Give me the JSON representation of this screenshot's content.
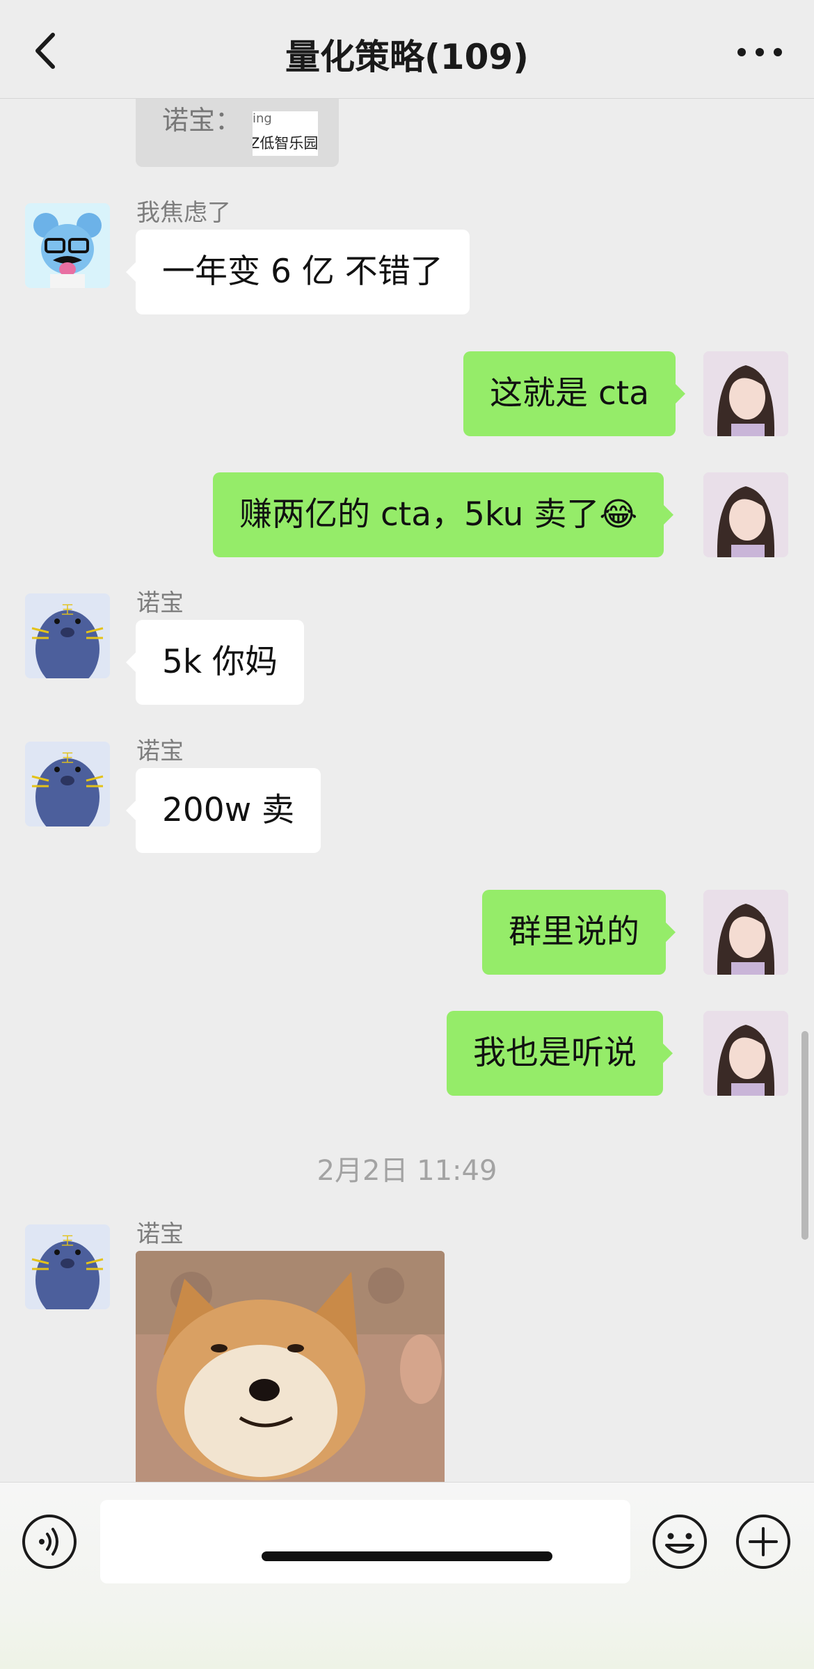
{
  "header": {
    "title": "量化策略(109)",
    "back_icon": "chevron-left-icon",
    "more_icon": "more-dots-icon"
  },
  "quote": {
    "name": "诺宝：",
    "thumb_line1": "ing",
    "thumb_line2": "Z低智乐园"
  },
  "messages": [
    {
      "side": "left",
      "sender": "我焦虑了",
      "text": "一年变 6 亿 不错了"
    },
    {
      "side": "right",
      "text": "这就是 cta"
    },
    {
      "side": "right",
      "text": "赚两亿的 cta，5ku 卖了😂"
    },
    {
      "side": "left",
      "sender": "诺宝",
      "text": "5k 你妈"
    },
    {
      "side": "left",
      "sender": "诺宝",
      "text": "200w 卖"
    },
    {
      "side": "right",
      "text": "群里说的"
    },
    {
      "side": "right",
      "text": "我也是听说"
    },
    {
      "side": "left",
      "sender": "诺宝",
      "type": "image",
      "image": "shiba-dog-meme"
    }
  ],
  "timestamp": "2月2日 11:49",
  "input": {
    "placeholder": "",
    "voice_icon": "voice-icon",
    "emoji_icon": "emoji-icon",
    "plus_icon": "plus-icon"
  },
  "colors": {
    "background": "#ededed",
    "bubble_right": "#95ec69",
    "bubble_left": "#ffffff",
    "meta_text": "#7d7d7d"
  }
}
